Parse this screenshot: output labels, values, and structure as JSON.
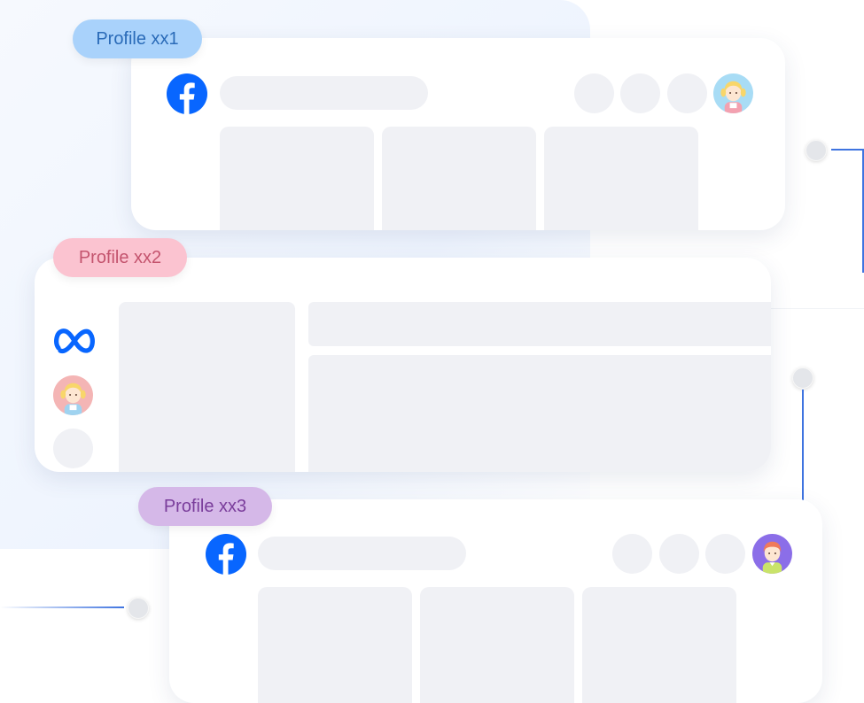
{
  "profiles": [
    {
      "label": "Profile xx1",
      "pill_bg": "#a9d2fb",
      "pill_color": "#2a6bb8",
      "platform": "facebook-icon"
    },
    {
      "label": "Profile xx2",
      "pill_bg": "#fbc3d0",
      "pill_color": "#c4546e",
      "platform": "meta-icon"
    },
    {
      "label": "Profile xx3",
      "pill_bg": "#d5b8e8",
      "pill_color": "#7a3d9b",
      "platform": "facebook-icon"
    }
  ],
  "colors": {
    "facebook_blue": "#0866ff",
    "placeholder": "#f0f1f5",
    "connector_line": "#3f74e0"
  },
  "icons": [
    "facebook-icon",
    "meta-icon",
    "avatar-girl-icon",
    "avatar-boy-icon"
  ]
}
